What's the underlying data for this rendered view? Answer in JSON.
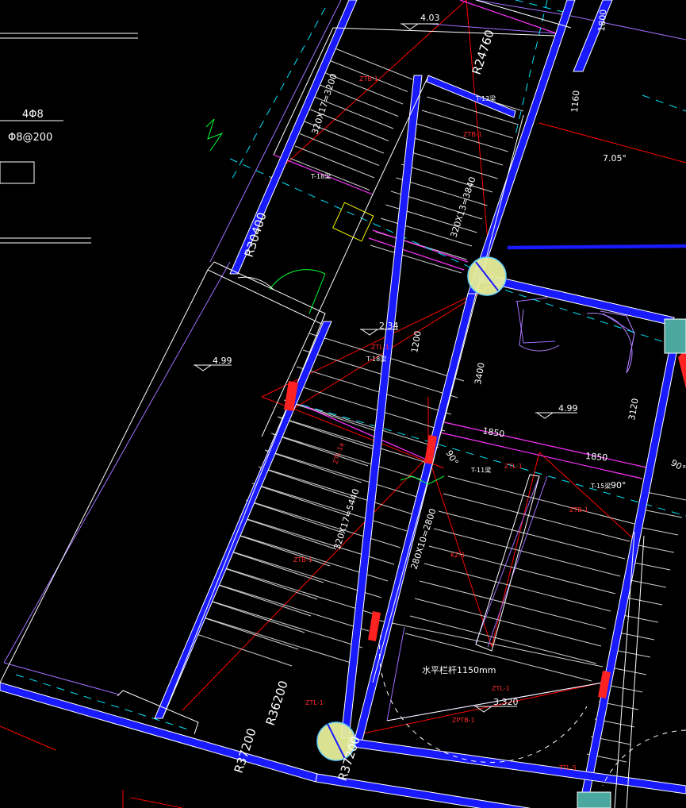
{
  "colors": {
    "background": "#000000",
    "wall": "#ffffff",
    "wall_fill": "#1a1aff",
    "grid": "#ff0000",
    "hatch": "#d8d8d8",
    "railing": "#ff00ff",
    "cyan": "#00e5ff",
    "purple": "#b080ff",
    "green": "#00ff33",
    "yellow": "#ffff00",
    "node_fill": "#e8f0a0",
    "node_stroke": "#5fd0ff"
  },
  "left_notes": {
    "rebar_main": "4Φ8",
    "rebar_stirrup": "Φ8@200"
  },
  "elevations": {
    "top": "4.03",
    "left": "4.99",
    "landing_mid": "2.34",
    "right_room": "4.99",
    "lower": "3.320"
  },
  "radius_labels": {
    "r24760": "R24760",
    "r30400": "R30400",
    "r36200": "R36200",
    "r37200_left": "R37200",
    "r37200_right": "R37200"
  },
  "dimensions": {
    "d1800": "1800",
    "d1160": "1160",
    "d1200": "1200",
    "d3400": "3400",
    "d3120": "3120",
    "d1850_a": "1850",
    "d1850_b": "1850",
    "angle_7": "7.05°",
    "angle_90a": "90°",
    "angle_90b": "90°",
    "angle_90c": "90°"
  },
  "stair_labels": {
    "flight_upper_left": "320X17=3200",
    "flight_upper_right": "320X13=3840",
    "flight_lower_left": "320X17=5440",
    "flight_lower_right": "280X10=2800"
  },
  "red_tags": {
    "ztl_a": "ZTL-1",
    "ztl_b": "ZTL-1a",
    "ztl_c": "ZTL-1",
    "ztl_d": "ZTL-1",
    "ztl_e": "ZTL-1",
    "ztb_a": "ZTB-1",
    "ztb_b": "ZTB-1",
    "ztb_c": "ZTB-1",
    "ztb_d": "ZTB-1",
    "zpb": "ZPTB-1",
    "kz": "KZ-1",
    "ttl": "TTL-5"
  },
  "white_tags": {
    "t1": "T-13梁",
    "t2": "T-18梁",
    "t3": "T-18梁",
    "t4": "T-11梁",
    "t5": "T-15梁"
  },
  "railing_note": "水平栏杆1150mm"
}
